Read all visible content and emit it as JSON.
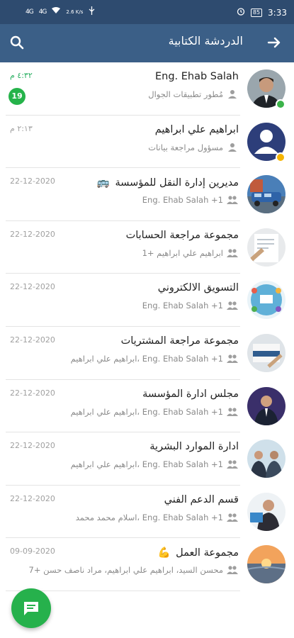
{
  "status_bar": {
    "signal1": "4G",
    "signal2": "4G",
    "net_speed": "2.6 K/s",
    "battery": "85",
    "time": "3:33"
  },
  "header": {
    "title": "الدردشة الكتابية",
    "back_icon": "arrow-right-icon",
    "search_icon": "search-icon"
  },
  "chats": [
    {
      "title": "Eng. Ehab Salah",
      "subtitle": "مُطور تطبيقات الجوال",
      "time": "٤:٣٢ م",
      "unread": "19",
      "type": "person",
      "presence": "#3cb34a"
    },
    {
      "title": "ابراهيم علي ابراهيم",
      "subtitle": "مسؤول مراجعة بيانات",
      "time": "٢:١٣ م",
      "type": "person",
      "presence": "#f5b400"
    },
    {
      "title": "مديرين إدارة النقل للمؤسسة",
      "subtitle": "Eng. Ehab Salah +1",
      "time": "22-12-2020",
      "type": "group",
      "emoji": "🚌"
    },
    {
      "title": "مجموعة مراجعة الحسابات",
      "subtitle": "ابراهيم علي ابراهيم +1",
      "time": "22-12-2020",
      "type": "group"
    },
    {
      "title": "التسويق الالكتروني",
      "subtitle": "Eng. Ehab Salah +1",
      "time": "22-12-2020",
      "type": "group"
    },
    {
      "title": "مجموعة مراجعة المشتريات",
      "subtitle": "Eng. Ehab Salah +1 ،ابراهيم علي ابراهيم",
      "time": "22-12-2020",
      "type": "group"
    },
    {
      "title": "مجلس ادارة المؤسسة",
      "subtitle": "Eng. Ehab Salah +1 ،ابراهيم علي ابراهيم",
      "time": "22-12-2020",
      "type": "group"
    },
    {
      "title": "ادارة الموارد البشرية",
      "subtitle": "Eng. Ehab Salah +1 ،ابراهيم علي ابراهيم",
      "time": "22-12-2020",
      "type": "group"
    },
    {
      "title": "قسم الدعم الفني",
      "subtitle": "Eng. Ehab Salah +1 ،اسلام محمد محمد",
      "time": "22-12-2020",
      "type": "group"
    },
    {
      "title": "مجموعة العمل",
      "subtitle": "محسن السيد، ابراهيم علي ابراهيم، مراد ناصف حسن +7",
      "time": "09-09-2020",
      "type": "group",
      "emoji": "💪"
    }
  ],
  "fab": {
    "icon": "chat-bubble-icon"
  },
  "colors": {
    "status_bar": "#2e4b6f",
    "app_bar": "#3b5f87",
    "accent": "#26b14c"
  }
}
